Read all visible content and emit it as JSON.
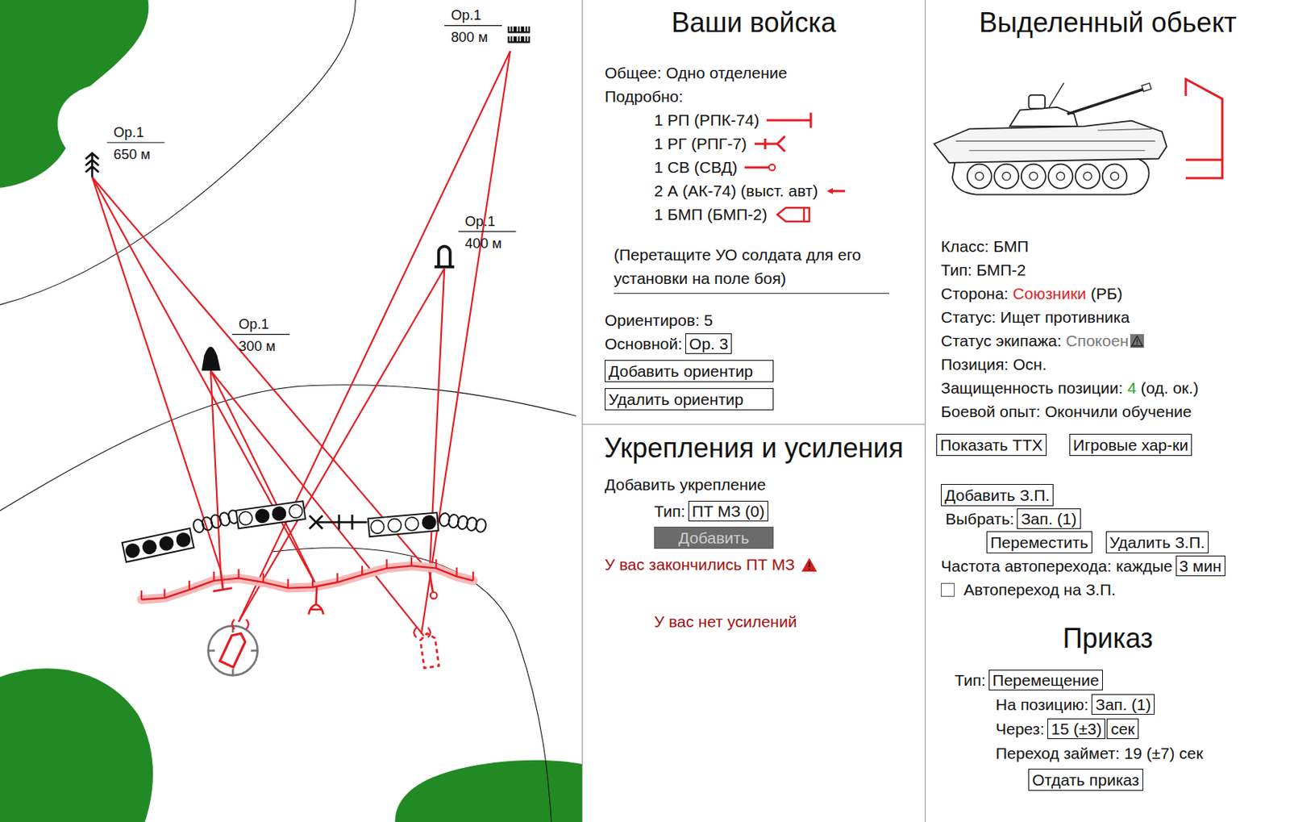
{
  "map": {
    "landmarks": [
      {
        "kind": "marsh",
        "label": "Ор.1",
        "distance": "800 м"
      },
      {
        "kind": "tree",
        "label": "Ор.1",
        "distance": "650 м"
      },
      {
        "kind": "bunker",
        "label": "Ор.1",
        "distance": "400 м"
      },
      {
        "kind": "mound",
        "label": "Ор.1",
        "distance": "300 м"
      }
    ],
    "fortifications": [
      {
        "kind": "minefield",
        "mines": [
          true,
          true,
          true,
          true
        ]
      },
      {
        "kind": "wire",
        "mines": []
      },
      {
        "kind": "minefield",
        "mines": [
          false,
          true,
          true,
          false
        ]
      },
      {
        "kind": "hedgehog",
        "mines": []
      },
      {
        "kind": "minefield",
        "mines": [
          false,
          false,
          false,
          true
        ]
      },
      {
        "kind": "wire",
        "mines": []
      }
    ],
    "units": [
      {
        "kind": "rp",
        "selected": false
      },
      {
        "kind": "rg",
        "selected": false
      },
      {
        "kind": "sv",
        "selected": false
      },
      {
        "kind": "bmp",
        "selected": true
      },
      {
        "kind": "bmp-reserve",
        "selected": false
      }
    ]
  },
  "troops": {
    "title": "Ваши войска",
    "summary": "Общее: Одно отделение",
    "details_label": "Подробно:",
    "items": [
      {
        "text": "1 РП (РПК-74)",
        "kind": "rp"
      },
      {
        "text": "1 РГ (РПГ-7)",
        "kind": "rg"
      },
      {
        "text": "1 СВ (СВД)",
        "kind": "sv"
      },
      {
        "text": "2 А (АК-74) (выст. авт)",
        "kind": "a"
      },
      {
        "text": "1 БМП (БМП-2)",
        "kind": "bmp"
      }
    ],
    "hint": "(Перетащите УО солдата для его установки на поле боя)",
    "landmarks_count": "Ориентиров: 5",
    "main_label": "Основной:",
    "main_value": "Ор. 3",
    "buttons": [
      "Добавить ориентир",
      "Удалить ориентир"
    ]
  },
  "fortifications_panel": {
    "title": "Укрепления и усиления",
    "add_label": "Добавить укрепление",
    "type_label": "Тип:",
    "type_value": "ПТ МЗ (0)",
    "add_button": {
      "label": "Добавить",
      "disabled": true
    },
    "warning": "У вас закончились ПТ МЗ",
    "no_reinforcements": "У вас нет усилений"
  },
  "selected": {
    "title": "Выделенный обьект",
    "fields": [
      {
        "label": "Класс:",
        "value": "БМП",
        "suffix": "",
        "kind": "plain",
        "warning": false
      },
      {
        "label": "Тип:",
        "value": "БМП-2",
        "suffix": "",
        "kind": "plain",
        "warning": false
      },
      {
        "label": "Сторона:",
        "value": "Союзники",
        "suffix": "(РБ)",
        "kind": "alert",
        "warning": false
      },
      {
        "label": "Статус:",
        "value": "Ищет противника",
        "suffix": "",
        "kind": "plain",
        "warning": false
      },
      {
        "label": "Статус экипажа:",
        "value": "Спокоен",
        "suffix": "",
        "kind": "muted",
        "warning": true
      },
      {
        "label": "Позиция:",
        "value": "Осн.",
        "suffix": "",
        "kind": "plain",
        "warning": false
      },
      {
        "label": "Защищенность позиции:",
        "value": "4",
        "suffix": "(од. ок.)",
        "kind": "good",
        "warning": false
      },
      {
        "label": "Боевой опыт:",
        "value": "Окончили обучение",
        "suffix": "",
        "kind": "plain",
        "warning": false
      }
    ],
    "buttons": [
      "Показать ТТХ",
      "Игровые хар-ки"
    ],
    "reserve": {
      "add_button": "Добавить З.П.",
      "select_label": "Выбрать:",
      "select_value": "Зап. (1)",
      "move_button": "Переместить",
      "delete_button": "Удалить З.П.",
      "frequency_label": "Частота автоперехода: каждые",
      "frequency_value": "3 мин",
      "auto_label": "Автопереход на З.П.",
      "auto_checked": false
    }
  },
  "order": {
    "title": "Приказ",
    "type_label": "Тип:",
    "type_value": "Перемещение",
    "position_label": "На позицию:",
    "position_value": "Зап. (1)",
    "delay_label": "Через:",
    "delay_value": "15 (±3)",
    "delay_unit": "сек",
    "duration": "Переход займет: 19 (±7) сек",
    "submit": "Отдать приказ"
  }
}
